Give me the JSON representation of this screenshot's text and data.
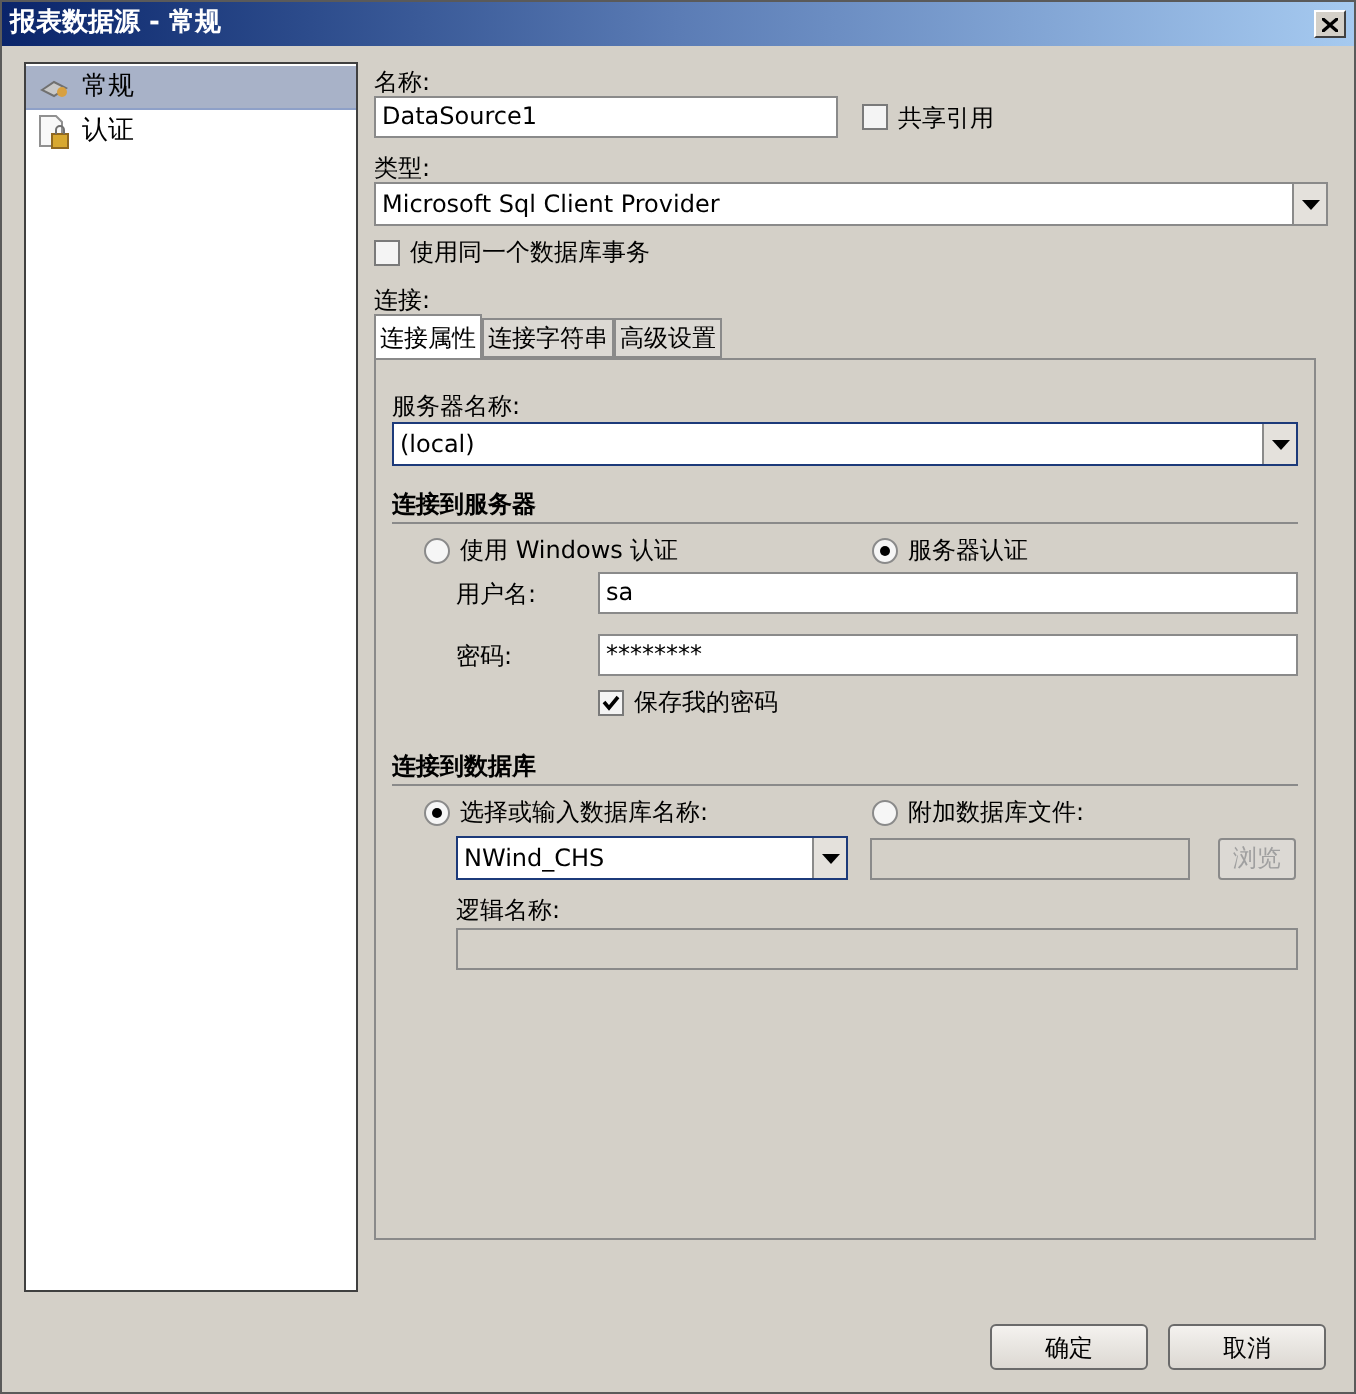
{
  "window": {
    "title": "报表数据源 - 常规"
  },
  "sidebar": {
    "items": [
      {
        "label": "常规",
        "selected": true,
        "kind": "settings"
      },
      {
        "label": "认证",
        "selected": false,
        "kind": "lock"
      }
    ]
  },
  "name_field": {
    "label": "名称:",
    "value": "DataSource1"
  },
  "shared_reference": {
    "label": "共享引用",
    "checked": false
  },
  "type_field": {
    "label": "类型:",
    "value": "Microsoft Sql Client Provider"
  },
  "same_transaction": {
    "label": "使用同一个数据库事务",
    "checked": false
  },
  "connection": {
    "label": "连接:",
    "tabs": [
      {
        "label": "连接属性",
        "selected": true
      },
      {
        "label": "连接字符串",
        "selected": false
      },
      {
        "label": "高级设置",
        "selected": false
      }
    ],
    "server_name": {
      "label": "服务器名称:",
      "value": "(local)"
    },
    "server_section": {
      "title": "连接到服务器",
      "auth_options": [
        {
          "label": "使用 Windows 认证",
          "selected": false
        },
        {
          "label": "服务器认证",
          "selected": true
        }
      ],
      "username": {
        "label": "用户名:",
        "value": "sa"
      },
      "password": {
        "label": "密码:",
        "value": "********"
      },
      "save_password": {
        "label": "保存我的密码",
        "checked": true
      }
    },
    "database_section": {
      "title": "连接到数据库",
      "options": [
        {
          "label": "选择或输入数据库名称:",
          "selected": true
        },
        {
          "label": "附加数据库文件:",
          "selected": false
        }
      ],
      "database": {
        "value": "NWind_CHS"
      },
      "attach_file": {
        "disabled": true
      },
      "browse_button": {
        "label": "浏览",
        "disabled": true
      },
      "logical_name": {
        "label": "逻辑名称:",
        "disabled": true
      }
    }
  },
  "buttons": [
    {
      "label": "确定"
    },
    {
      "label": "取消"
    }
  ]
}
